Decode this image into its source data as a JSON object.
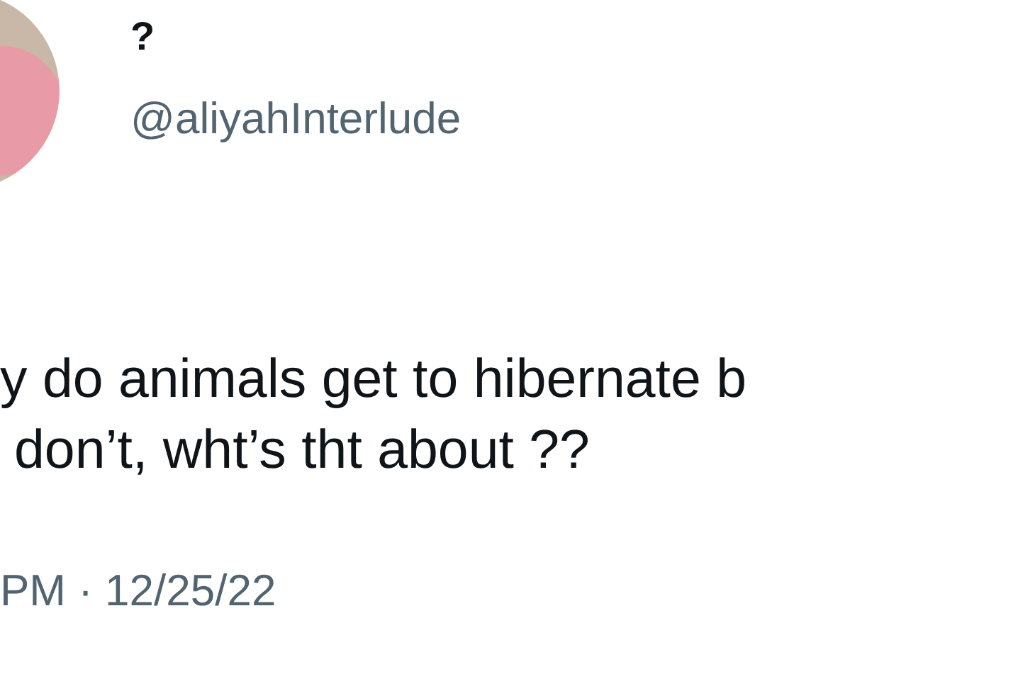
{
  "author": {
    "name": "?",
    "handle": "@aliyahInterlude"
  },
  "tweet": {
    "lines": [
      "y do animals get to hibernate b",
      "don’t, wht’s tht about ??"
    ]
  },
  "timestamp": "PM · 12/25/22"
}
